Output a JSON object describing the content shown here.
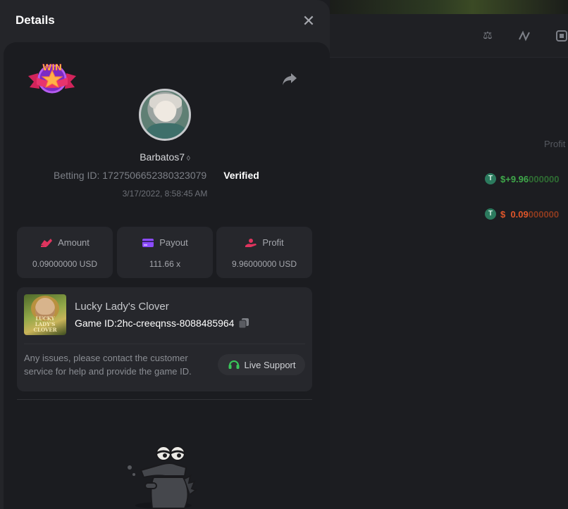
{
  "modal": {
    "title": "Details",
    "close_icon": "close-icon",
    "badge": {
      "text": "WIN",
      "icon": "win-star-badge"
    },
    "share_icon": "share-arrow-icon",
    "user": {
      "name": "Barbatos7",
      "bet_id": "Betting ID: 1727506652380323079",
      "verified": "Verified",
      "date": "3/17/2022, 8:58:45 AM"
    },
    "stats": [
      {
        "label": "Amount",
        "value": "0.09000000 USD",
        "icon": "amount-icon",
        "color": "#e0345e"
      },
      {
        "label": "Payout",
        "value": "111.66 x",
        "icon": "payout-card-icon",
        "color": "#8c4bff"
      },
      {
        "label": "Profit",
        "value": "9.96000000 USD",
        "icon": "profit-hand-icon",
        "color": "#e0345e"
      }
    ],
    "game": {
      "thumb_title": "LUCKY LADY'S CLOVER",
      "name": "Lucky Lady's Clover",
      "id": "Game ID:2hc-creeqnss-8088485964",
      "note": "Any issues, please contact the customer service for help and provide the game ID.",
      "support_label": "Live Support"
    }
  },
  "background": {
    "profit_header": "Profit",
    "rows": [
      {
        "currency": "T",
        "prefix": "$+9.96",
        "suffix": "000000",
        "color": "#3fa84a"
      },
      {
        "currency": "T",
        "prefix": "$  0.09",
        "suffix": "000000",
        "color": "#e0562a"
      }
    ]
  }
}
